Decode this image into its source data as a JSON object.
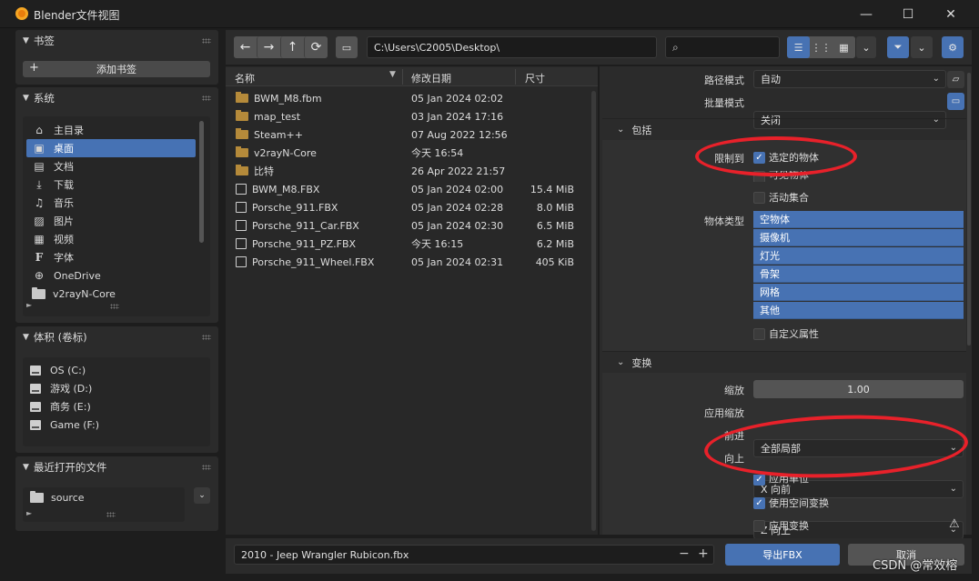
{
  "window": {
    "title": "Blender文件视图",
    "min": "—",
    "max": "☐",
    "close": "✕"
  },
  "sidebar": {
    "bookmarks": {
      "title": "书签",
      "add": "添加书签"
    },
    "system": {
      "title": "系统",
      "items": [
        {
          "label": "主目录",
          "icon": "home-icon"
        },
        {
          "label": "桌面",
          "icon": "desktop-icon"
        },
        {
          "label": "文档",
          "icon": "document-icon"
        },
        {
          "label": "下载",
          "icon": "download-icon"
        },
        {
          "label": "音乐",
          "icon": "music-icon"
        },
        {
          "label": "图片",
          "icon": "image-icon"
        },
        {
          "label": "视频",
          "icon": "video-icon"
        },
        {
          "label": "字体",
          "icon": "font-icon"
        },
        {
          "label": "OneDrive",
          "icon": "globe-icon"
        },
        {
          "label": "v2rayN-Core",
          "icon": "folder-icon"
        }
      ]
    },
    "volumes": {
      "title": "体积 (卷标)",
      "items": [
        "OS (C:)",
        "游戏 (D:)",
        "商务 (E:)",
        "Game (F:)"
      ]
    },
    "recent": {
      "title": "最近打开的文件",
      "items": [
        "source"
      ]
    }
  },
  "toolbar": {
    "path": "C:\\Users\\C2005\\Desktop\\",
    "search_placeholder": ""
  },
  "filelist": {
    "headers": {
      "name": "名称",
      "date": "修改日期",
      "size": "尺寸"
    },
    "rows": [
      {
        "name": "BWM_M8.fbm",
        "date": "05 Jan 2024 02:02",
        "size": "",
        "type": "folder"
      },
      {
        "name": "map_test",
        "date": "03 Jan 2024 17:16",
        "size": "",
        "type": "folder"
      },
      {
        "name": "Steam++",
        "date": "07 Aug 2022 12:56",
        "size": "",
        "type": "folder"
      },
      {
        "name": "v2rayN-Core",
        "date": "今天 16:54",
        "size": "",
        "type": "folder"
      },
      {
        "name": "比特",
        "date": "26 Apr 2022 21:57",
        "size": "",
        "type": "folder"
      },
      {
        "name": "BWM_M8.FBX",
        "date": "05 Jan 2024 02:00",
        "size": "15.4 MiB",
        "type": "file"
      },
      {
        "name": "Porsche_911.FBX",
        "date": "05 Jan 2024 02:28",
        "size": "8.0 MiB",
        "type": "file"
      },
      {
        "name": "Porsche_911_Car.FBX",
        "date": "05 Jan 2024 02:30",
        "size": "6.5 MiB",
        "type": "file"
      },
      {
        "name": "Porsche_911_PZ.FBX",
        "date": "今天 16:15",
        "size": "6.2 MiB",
        "type": "file"
      },
      {
        "name": "Porsche_911_Wheel.FBX",
        "date": "05 Jan 2024 02:31",
        "size": "405 KiB",
        "type": "file"
      }
    ]
  },
  "settings": {
    "path_mode_label": "路径模式",
    "path_mode_value": "自动",
    "batch_mode_label": "批量模式",
    "batch_mode_value": "关闭",
    "include_title": "包括",
    "limit_label": "限制到",
    "selected_objects": "选定的物体",
    "visible_objects": "可见物体",
    "active_collection": "活动集合",
    "object_types_label": "物体类型",
    "object_types": [
      "空物体",
      "摄像机",
      "灯光",
      "骨架",
      "网格",
      "其他"
    ],
    "custom_props": "自定义属性",
    "transform_title": "变换",
    "scale_label": "缩放",
    "scale_value": "1.00",
    "apply_scale_label": "应用缩放",
    "apply_scale_value": "全部局部",
    "forward_label": "前进",
    "forward_value": "X 向前",
    "up_label": "向上",
    "up_value": "Z 向上",
    "apply_unit": "应用单位",
    "space_transform": "使用空间变换",
    "apply_transform": "应用变换"
  },
  "footer": {
    "filename": "2010 - Jeep Wrangler Rubicon.fbx",
    "export": "导出FBX",
    "cancel": "取消",
    "watermark": "CSDN @常效榕"
  },
  "colors": {
    "accent": "#4772b3",
    "annotation": "#e8212a"
  }
}
